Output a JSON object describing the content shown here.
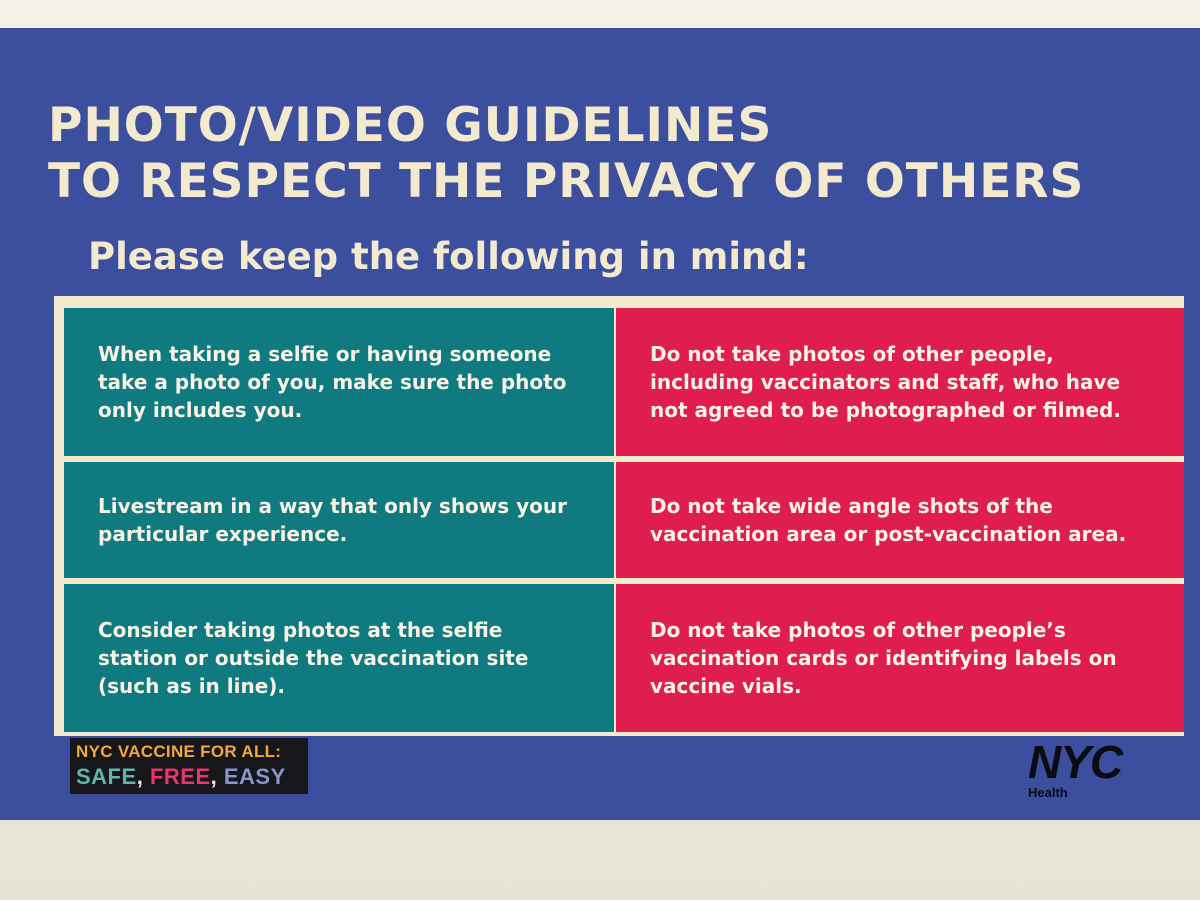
{
  "sign": {
    "title": "PHOTO/VIDEO GUIDELINES\nTO RESPECT THE PRIVACY OF OTHERS",
    "subtitle": "Please keep the following in mind:",
    "rows": [
      {
        "do": "When taking a selfie or having someone take a photo of you, make sure the photo only includes you.",
        "dont": "Do not take photos of other people, including vaccinators and staff, who have not agreed to be photographed or filmed."
      },
      {
        "do": "Livestream in a way that only shows your particular experience.",
        "dont": "Do not take wide angle shots of the vaccination area or post-vaccination area."
      },
      {
        "do": "Consider taking photos at the selfie station or outside the vaccination site (such as in line).",
        "dont": "Do not take photos of other people’s vaccination cards or identifying labels on vaccine vials."
      }
    ],
    "badge": {
      "line1": "NYC VACCINE FOR ALL:",
      "safe": "SAFE",
      "free": "FREE",
      "easy": "EASY",
      "sep": ","
    },
    "logo": {
      "mark": "NYC",
      "sub": "Health"
    }
  },
  "colors": {
    "sign_blue": "#3b4f9e",
    "teal": "#0f7b80",
    "red": "#df1e4f",
    "cream": "#f3e9cf"
  }
}
